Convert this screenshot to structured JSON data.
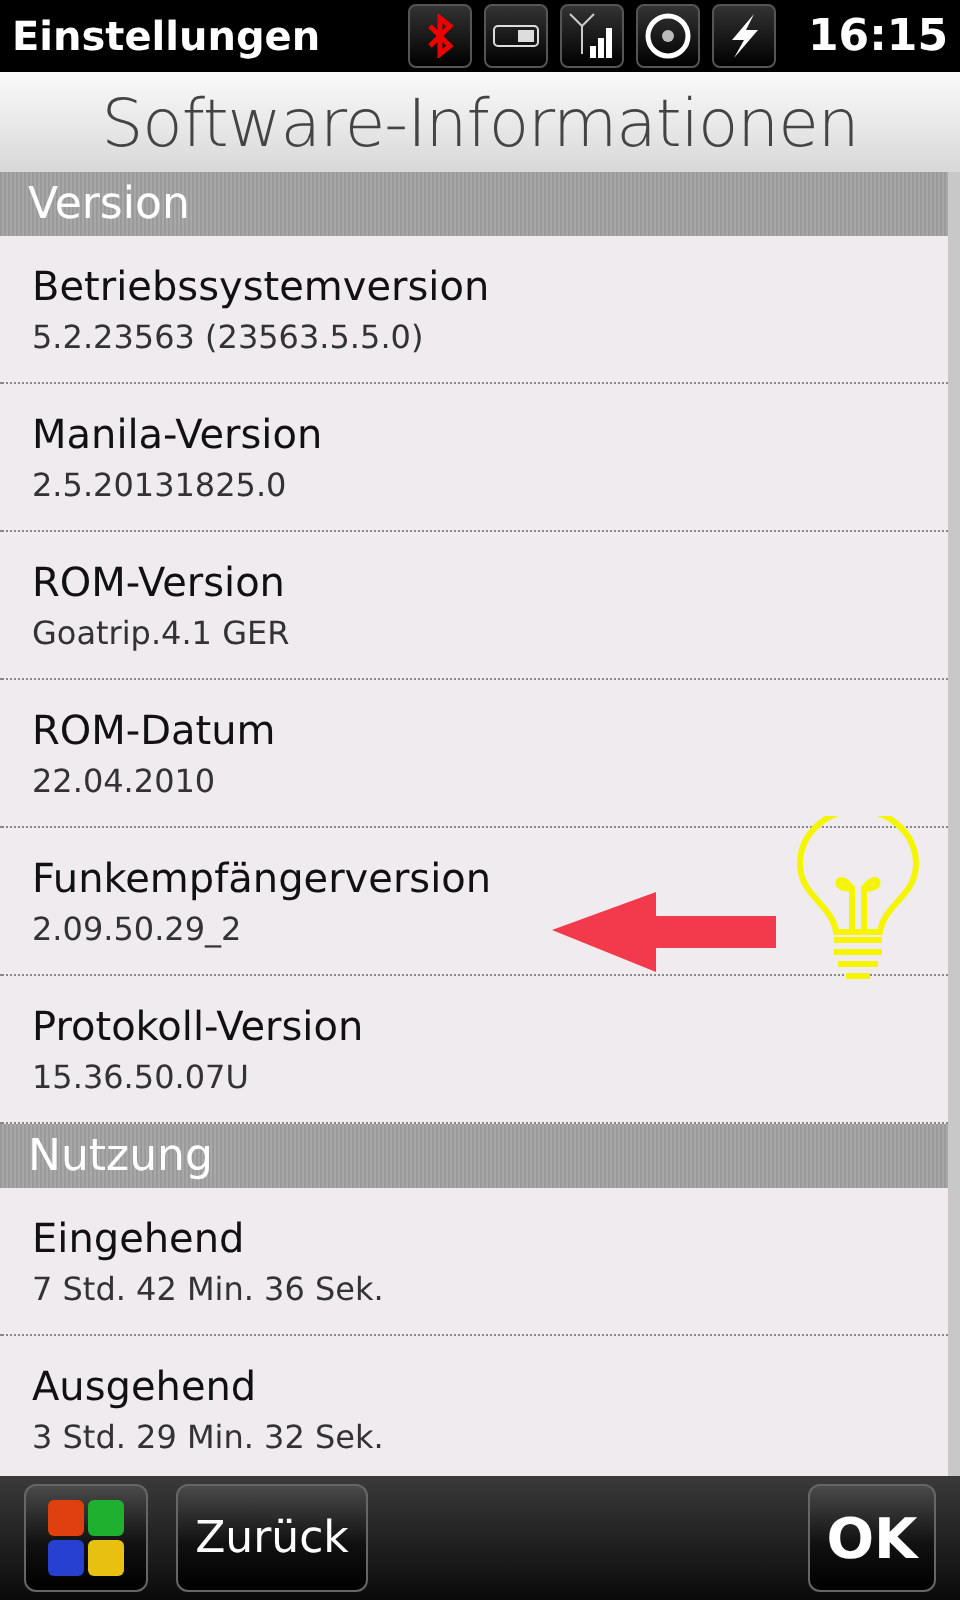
{
  "status_bar": {
    "title": "Einstellungen",
    "time": "16:15"
  },
  "header": {
    "title": "Software-Informationen"
  },
  "sections": [
    {
      "title": "Version",
      "items": [
        {
          "label": "Betriebssystemversion",
          "value": "5.2.23563 (23563.5.5.0)",
          "annotated": false
        },
        {
          "label": "Manila-Version",
          "value": "2.5.20131825.0",
          "annotated": false
        },
        {
          "label": "ROM-Version",
          "value": "Goatrip.4.1 GER",
          "annotated": false
        },
        {
          "label": "ROM-Datum",
          "value": "22.04.2010",
          "annotated": false
        },
        {
          "label": "Funkempfängerversion",
          "value": "2.09.50.29_2",
          "annotated": true
        },
        {
          "label": "Protokoll-Version",
          "value": "15.36.50.07U",
          "annotated": false
        }
      ]
    },
    {
      "title": "Nutzung",
      "items": [
        {
          "label": "Eingehend",
          "value": "7 Std. 42 Min. 36 Sek.",
          "annotated": false
        },
        {
          "label": "Ausgehend",
          "value": "3 Std. 29 Min. 32 Sek.",
          "annotated": false
        }
      ]
    }
  ],
  "toolbar": {
    "back": "Zurück",
    "ok": "OK"
  }
}
